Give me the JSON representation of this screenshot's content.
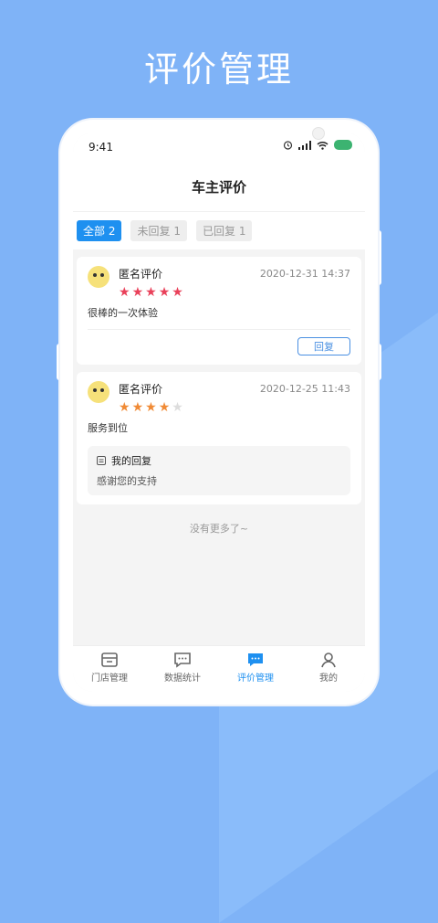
{
  "hero_title": "评价管理",
  "status": {
    "time": "9:41"
  },
  "nav": {
    "title": "车主评价"
  },
  "filters": [
    {
      "label": "全部",
      "count": "2"
    },
    {
      "label": "未回复",
      "count": "1"
    },
    {
      "label": "已回复",
      "count": "1"
    }
  ],
  "reviews": [
    {
      "name": "匿名评价",
      "date": "2020-12-31 14:37",
      "rating": 5,
      "content": "很棒的一次体验",
      "reply_button": "回复"
    },
    {
      "name": "匿名评价",
      "date": "2020-12-25 11:43",
      "rating": 4,
      "content": "服务到位",
      "reply": {
        "title": "我的回复",
        "text": "感谢您的支持"
      }
    }
  ],
  "no_more": "没有更多了~",
  "tabbar": [
    {
      "label": "门店管理",
      "icon": "store-icon"
    },
    {
      "label": "数据统计",
      "icon": "chat-chart-icon"
    },
    {
      "label": "评价管理",
      "icon": "review-icon",
      "active": true
    },
    {
      "label": "我的",
      "icon": "user-icon"
    }
  ],
  "colors": {
    "accent": "#1e90f0",
    "star_red": "#e9415a",
    "star_orange": "#f08a35",
    "background": "#7fb3f7"
  }
}
